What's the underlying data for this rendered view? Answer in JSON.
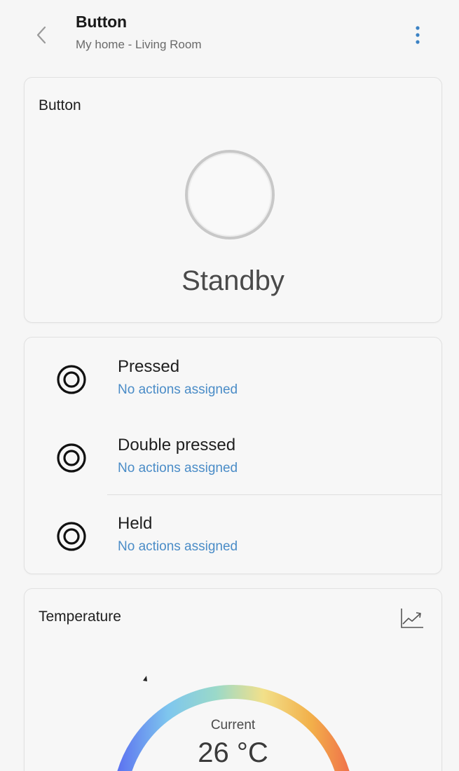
{
  "header": {
    "title": "Button",
    "subtitle": "My home - Living Room",
    "back_icon": "chevron-left-icon",
    "more_icon": "vertical-dots-icon"
  },
  "button_card": {
    "title": "Button",
    "state": "Standby"
  },
  "events": [
    {
      "name": "Pressed",
      "status": "No actions assigned",
      "icon": "button-press-icon"
    },
    {
      "name": "Double pressed",
      "status": "No actions assigned",
      "icon": "button-press-icon"
    },
    {
      "name": "Held",
      "status": "No actions assigned",
      "icon": "button-press-icon"
    }
  ],
  "temperature_card": {
    "title": "Temperature",
    "chart_icon": "trend-chart-icon",
    "current_label": "Current",
    "current_value": "26 °C"
  },
  "colors": {
    "accent": "#4a8cc7",
    "background": "#f6f6f6",
    "card": "#f7f7f7",
    "gauge_cold": "#5b6ff0",
    "gauge_cool": "#8fd8d8",
    "gauge_mild": "#f2e08a",
    "gauge_warm": "#f2b04a",
    "gauge_hot": "#f06a4a"
  }
}
